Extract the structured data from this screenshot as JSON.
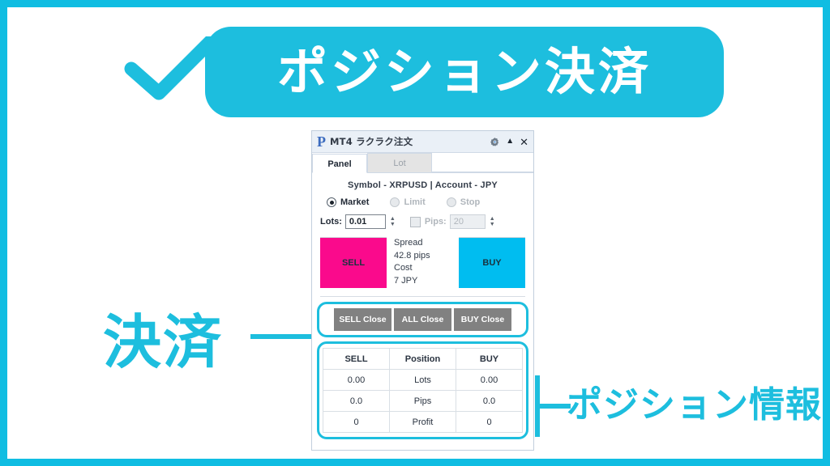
{
  "slide": {
    "border_color": "#10bde2",
    "background": "#ffffff",
    "header": {
      "check_icon": "check-icon",
      "title": "ポジション決済",
      "pill_color": "#1dbede",
      "title_color": "#ffffff"
    },
    "annotations": {
      "left": {
        "label": "決済",
        "color": "#1dbede"
      },
      "right": {
        "label": "ポジション情報",
        "color": "#1dbede"
      }
    }
  },
  "panel": {
    "titlebar": {
      "logo": "P",
      "title": "MT4 ラクラク注文",
      "buttons": [
        {
          "name": "settings-gear",
          "glyph": "gear-icon"
        },
        {
          "name": "collapse",
          "glyph": "▲"
        },
        {
          "name": "close",
          "glyph": "✕"
        }
      ],
      "collapse_glyph": "▲",
      "close_glyph": "✕"
    },
    "tabs": [
      {
        "label": "Panel",
        "active": true
      },
      {
        "label": "Lot",
        "active": false
      }
    ],
    "symbol_row": {
      "symbol_label": "Symbol -",
      "symbol_value": "XRPUSD",
      "separator": "|",
      "account_label": "Account -",
      "account_value": "JPY",
      "full_text": "Symbol - XRPUSD  |  Account - JPY"
    },
    "order_types": [
      {
        "label": "Market",
        "selected": true,
        "enabled": true
      },
      {
        "label": "Limit",
        "selected": false,
        "enabled": false
      },
      {
        "label": "Stop",
        "selected": false,
        "enabled": false
      }
    ],
    "lots_field": {
      "label": "Lots:",
      "value": "0.01",
      "stepper_up": "▲",
      "stepper_down": "▼"
    },
    "pips_field": {
      "checked": false,
      "label": "Pips:",
      "value": "20",
      "placeholder": "20",
      "enabled": false,
      "stepper_up": "▲",
      "stepper_down": "▼"
    },
    "trade": {
      "sell_label": "SELL",
      "sell_color": "#fa0a8c",
      "buy_label": "BUY",
      "buy_color": "#00bdf0",
      "spread_label": "Spread",
      "spread_value": "42.8 pips",
      "cost_label": "Cost",
      "cost_value": "7 JPY"
    },
    "close_buttons": [
      {
        "label": "SELL Close"
      },
      {
        "label": "ALL Close"
      },
      {
        "label": "BUY Close"
      }
    ],
    "position_table": {
      "headers": [
        "SELL",
        "Position",
        "BUY"
      ],
      "rows": [
        [
          "0.00",
          "Lots",
          "0.00"
        ],
        [
          "0.0",
          "Pips",
          "0.0"
        ],
        [
          "0",
          "Profit",
          "0"
        ]
      ]
    }
  }
}
